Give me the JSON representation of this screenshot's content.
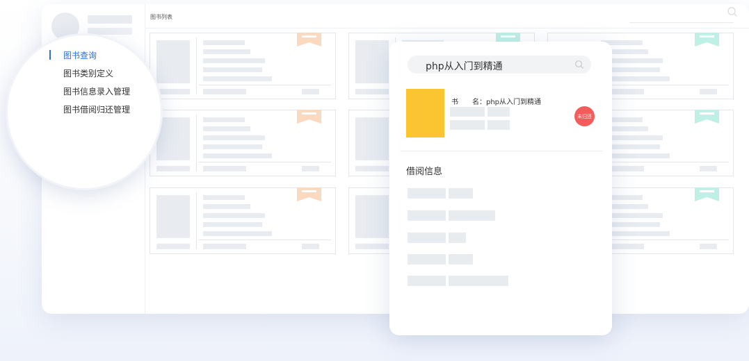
{
  "page_title": "图书列表",
  "sidebar": {
    "items": [
      {
        "label": "图书查询",
        "active": true
      },
      {
        "label": "图书类别定义",
        "active": false
      },
      {
        "label": "图书信息录入管理",
        "active": false
      },
      {
        "label": "图书借阅归还管理",
        "active": false
      }
    ]
  },
  "search": {
    "query": "php从入门到精通",
    "icon": "search-icon"
  },
  "book": {
    "name_label": "书　　名：",
    "name_value": "php从入门到精通",
    "status_badge": "未归还",
    "cover_color": "#fbc531"
  },
  "borrow_section": {
    "title": "借阅信息"
  },
  "colors": {
    "accent": "#2f6fd6",
    "badge": "#f45b5b",
    "ribbon_orange": "#fbd9bf",
    "ribbon_teal": "#bff0e6"
  }
}
